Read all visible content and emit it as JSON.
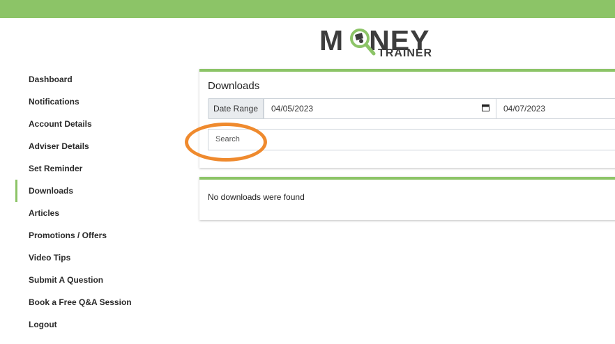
{
  "brand": {
    "logo_main": "MONEY",
    "logo_sub": "TRAINER"
  },
  "sidebar": {
    "active_index": 5,
    "items": [
      {
        "label": "Dashboard"
      },
      {
        "label": "Notifications"
      },
      {
        "label": "Account Details"
      },
      {
        "label": "Adviser Details"
      },
      {
        "label": "Set Reminder"
      },
      {
        "label": "Downloads"
      },
      {
        "label": "Articles"
      },
      {
        "label": "Promotions / Offers"
      },
      {
        "label": "Video Tips"
      },
      {
        "label": "Submit A Question"
      },
      {
        "label": "Book a Free Q&A Session"
      },
      {
        "label": "Logout"
      }
    ]
  },
  "downloads": {
    "title": "Downloads",
    "date_range_label": "Date Range",
    "date_from": "04/05/2023",
    "date_to": "04/07/2023",
    "search_placeholder": "Search",
    "empty_message": "No downloads were found"
  },
  "colors": {
    "accent": "#8cc467",
    "highlight": "#ef8a2e"
  }
}
